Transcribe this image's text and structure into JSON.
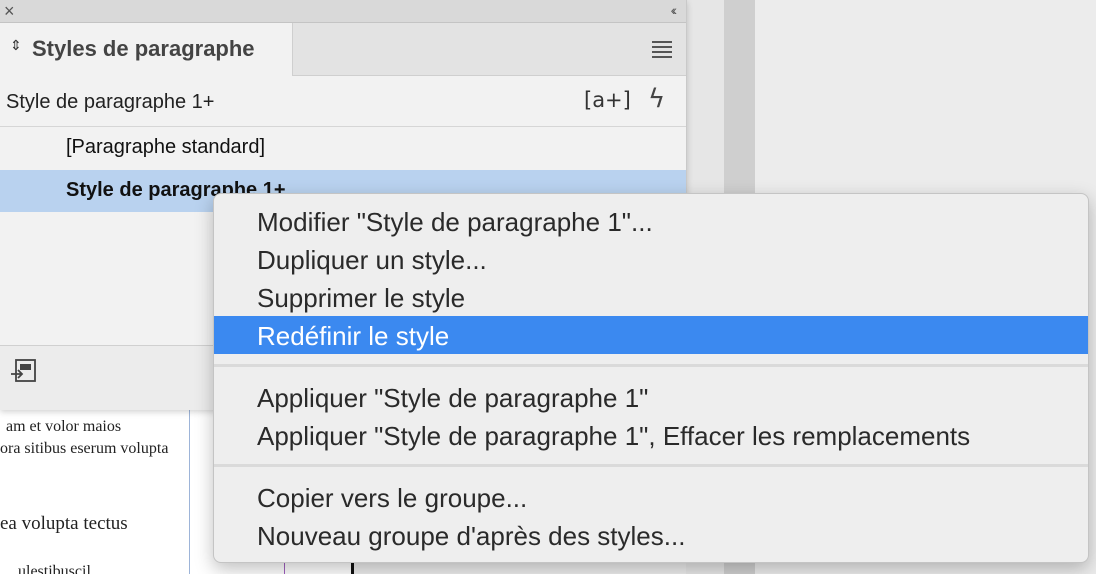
{
  "panel": {
    "title": "Styles de paragraphe",
    "close_glyph": "×",
    "collapse_glyph": "‹‹",
    "current_style": "Style de paragraphe 1+",
    "new_style_icon": "[a+]",
    "bolt_icon": "ϟ",
    "tab_arrows": "⇕",
    "styles": [
      {
        "label": "[Paragraphe standard]"
      },
      {
        "label": "Style de paragraphe 1+"
      }
    ]
  },
  "context_menu": {
    "items": [
      "Modifier \"Style de paragraphe 1\"...",
      "Dupliquer un style...",
      "Supprimer le style",
      "Redéfinir le style",
      "Appliquer \"Style de paragraphe 1\"",
      "Appliquer \"Style de paragraphe 1\", Effacer les remplacements",
      "Copier vers le groupe...",
      "Nouveau groupe d'après des styles..."
    ],
    "highlighted": "Redéfinir le style"
  },
  "document": {
    "lines": [
      "am et volor maios",
      "ora sitibus eserum volupta",
      "ea volupta tectus",
      "ulestibuscil"
    ]
  },
  "colors": {
    "highlight": "#3b89f0",
    "selected_row": "#b9d2ef"
  }
}
